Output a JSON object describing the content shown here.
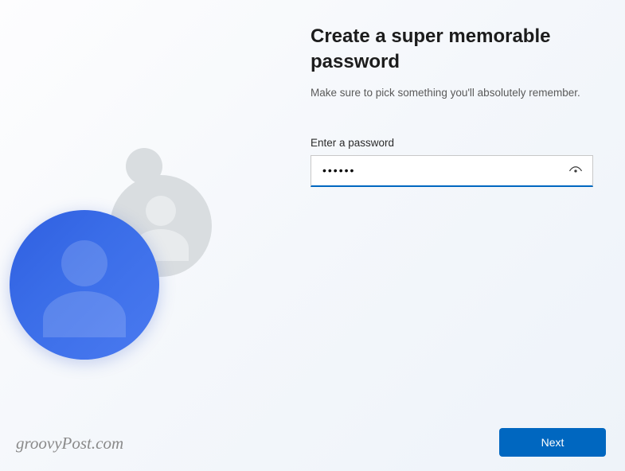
{
  "page": {
    "title": "Create a super memorable password",
    "subtitle": "Make sure to pick something you'll absolutely remember."
  },
  "form": {
    "password_label": "Enter a password",
    "password_value": "••••••"
  },
  "footer": {
    "next_label": "Next"
  },
  "watermark": {
    "text": "groovyPost.com"
  }
}
